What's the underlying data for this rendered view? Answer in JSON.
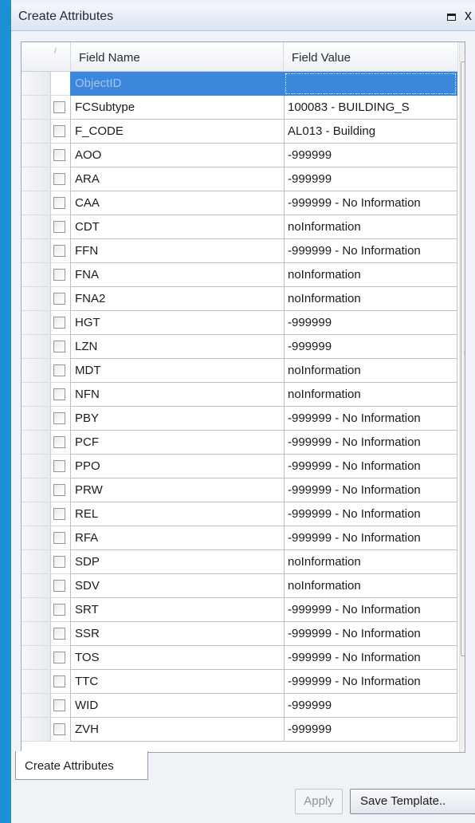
{
  "window": {
    "title": "Create Attributes",
    "restore_icon": "restore-icon",
    "close_glyph": "x"
  },
  "grid": {
    "columns": {
      "sort": "/",
      "name": "Field Name",
      "value": "Field Value"
    },
    "rows": [
      {
        "name": "ObjectID",
        "value": ""
      },
      {
        "name": "FCSubtype",
        "value": "100083 - BUILDING_S"
      },
      {
        "name": "F_CODE",
        "value": "AL013 - Building"
      },
      {
        "name": "AOO",
        "value": "-999999"
      },
      {
        "name": "ARA",
        "value": "-999999"
      },
      {
        "name": "CAA",
        "value": "-999999 - No Information"
      },
      {
        "name": "CDT",
        "value": "noInformation"
      },
      {
        "name": "FFN",
        "value": "-999999 - No Information"
      },
      {
        "name": "FNA",
        "value": "noInformation"
      },
      {
        "name": "FNA2",
        "value": "noInformation"
      },
      {
        "name": "HGT",
        "value": "-999999"
      },
      {
        "name": "LZN",
        "value": "-999999"
      },
      {
        "name": "MDT",
        "value": "noInformation"
      },
      {
        "name": "NFN",
        "value": "noInformation"
      },
      {
        "name": "PBY",
        "value": "-999999 - No Information"
      },
      {
        "name": "PCF",
        "value": "-999999 - No Information"
      },
      {
        "name": "PPO",
        "value": "-999999 - No Information"
      },
      {
        "name": "PRW",
        "value": "-999999 - No Information"
      },
      {
        "name": "REL",
        "value": "-999999 - No Information"
      },
      {
        "name": "RFA",
        "value": "-999999 - No Information"
      },
      {
        "name": "SDP",
        "value": "noInformation"
      },
      {
        "name": "SDV",
        "value": "noInformation"
      },
      {
        "name": "SRT",
        "value": "-999999 - No Information"
      },
      {
        "name": "SSR",
        "value": "-999999 - No Information"
      },
      {
        "name": "TOS",
        "value": "-999999 - No Information"
      },
      {
        "name": "TTC",
        "value": "-999999 - No Information"
      },
      {
        "name": "WID",
        "value": "-999999"
      },
      {
        "name": "ZVH",
        "value": "-999999"
      }
    ]
  },
  "tabs": [
    {
      "label": "Create Attributes"
    }
  ],
  "footer": {
    "apply_label": "Apply",
    "save_template_label": "Save Template.."
  },
  "colors": {
    "titlebar": "#dbe5f2",
    "selection": "#3c86dc",
    "desktop": "#1d8fd4"
  }
}
